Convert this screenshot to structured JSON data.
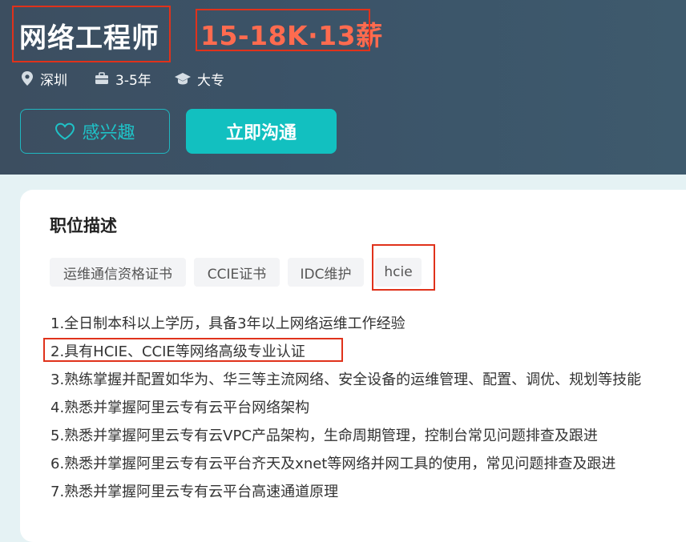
{
  "job": {
    "title": "网络工程师",
    "salary": "15-18K·13薪",
    "location": "深圳",
    "experience": "3-5年",
    "education": "大专"
  },
  "actions": {
    "follow_label": "感兴趣",
    "chat_label": "立即沟通"
  },
  "description": {
    "heading": "职位描述",
    "tags": [
      "运维通信资格证书",
      "CCIE证书",
      "IDC维护",
      "hcie"
    ],
    "requirements": [
      "1.全日制本科以上学历，具备3年以上网络运维工作经验",
      "2.具有HCIE、CCIE等网络高级专业认证",
      "3.熟练掌握并配置如华为、华三等主流网络、安全设备的运维管理、配置、调优、规划等技能",
      "4.熟悉并掌握阿里云专有云平台网络架构",
      "5.熟悉并掌握阿里云专有云VPC产品架构，生命周期管理，控制台常见问题排查及跟进",
      "6.熟悉并掌握阿里云专有云平台齐天及xnet等网络并网工具的使用，常见问题排查及跟进",
      "7.熟悉并掌握阿里云专有云平台高速通道原理"
    ]
  },
  "icons": {
    "location": "location-pin-icon",
    "experience": "briefcase-icon",
    "education": "graduation-cap-icon",
    "follow": "heart-outline-icon"
  },
  "colors": {
    "header_bg": "#3c4e60",
    "salary": "#ff6b4f",
    "accent": "#12c0c0",
    "highlight_box": "#e0321b"
  }
}
